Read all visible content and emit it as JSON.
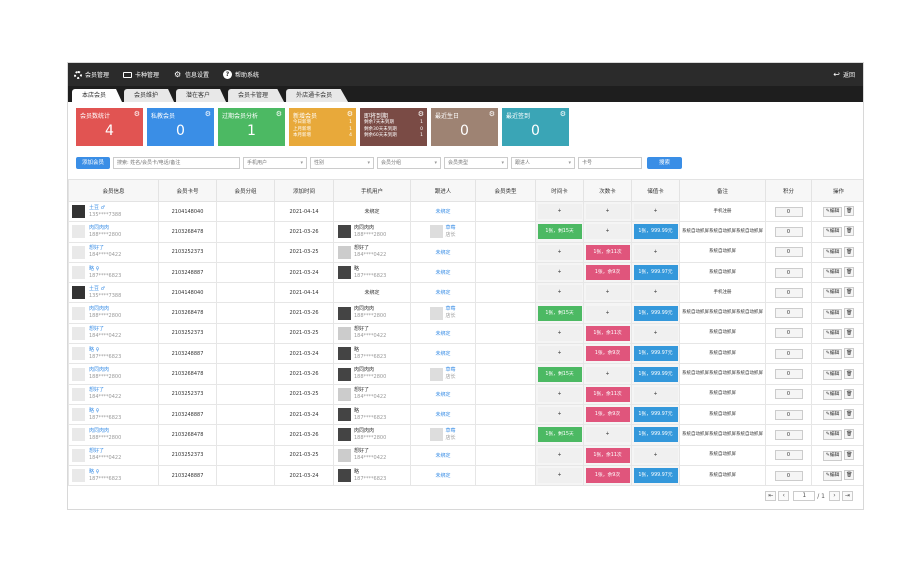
{
  "topnav": [
    {
      "label": "会员管理",
      "icon": "gear-icon"
    },
    {
      "label": "卡种管理",
      "icon": "card-icon"
    },
    {
      "label": "信息设置",
      "icon": "settings-icon"
    },
    {
      "label": "帮助系统",
      "icon": "help-icon"
    }
  ],
  "back_label": "返回",
  "tabs": [
    "本店会员",
    "会员维护",
    "潜在客户",
    "会员卡管理",
    "外店通卡会员"
  ],
  "cards": [
    {
      "title": "会员数统计",
      "value": "4",
      "color": "#e15452"
    },
    {
      "title": "私教会员",
      "value": "0",
      "color": "#3a8ee6"
    },
    {
      "title": "过期会员分析",
      "value": "1",
      "color": "#4cb963"
    },
    {
      "title": "新增会员",
      "color": "#e8a93a",
      "lines": [
        "今日新增",
        "上月新增",
        "本月新增"
      ],
      "counts": [
        "1",
        "1",
        "4"
      ]
    },
    {
      "title": "即将到期",
      "color": "#7a4b45",
      "lines": [
        "剩余7天未到期",
        "剩余30天未到期",
        "剩余60天未到期"
      ],
      "counts": [
        "1",
        "0",
        "1"
      ]
    },
    {
      "title": "最近生日",
      "value": "0",
      "color": "#9e8373"
    },
    {
      "title": "最近签到",
      "value": "0",
      "color": "#3aa5b6"
    }
  ],
  "filters": {
    "add_button": "添加会员",
    "search_placeholder": "搜索: 姓名/会员卡/电话/备注",
    "phone_user": "手机用户",
    "gender": "性别",
    "group": "会员分组",
    "type": "会员类型",
    "referrer": "跟进人",
    "card": "卡号",
    "search_button": "搜索"
  },
  "columns": [
    "会员信息",
    "会员卡号",
    "会员分组",
    "添加时间",
    "手机用户",
    "跟进人",
    "会员类型",
    "时间卡",
    "次数卡",
    "储值卡",
    "备注",
    "积分",
    "操作"
  ],
  "rows": [
    {
      "name": "土豆 ♂",
      "phone": "135****7388",
      "avatar": "d",
      "card": "2104148040",
      "date": "2021-04-14",
      "pu": "未绑定",
      "pu_av": "",
      "pu_phone": "",
      "ref": "未绑定",
      "ref_av": false,
      "time": "+",
      "time_c": "plain",
      "count": "+",
      "count_c": "plain",
      "stored": "+",
      "stored_c": "plain",
      "note": "手机注册",
      "score": "0"
    },
    {
      "name": "肉同肉肉",
      "phone": "188****2800",
      "avatar": "g",
      "card": "2103268478",
      "date": "2021-03-26",
      "pu": "肉同肉肉",
      "pu_av": "d",
      "pu_phone": "188****2800",
      "ref": "草莓",
      "ref_sub": "店长",
      "ref_av": true,
      "time": "1张，剩15天",
      "time_c": "green",
      "count": "+",
      "count_c": "plain",
      "stored": "1张，999.99元",
      "stored_c": "blue",
      "note": "系统自动抓屏系统自动抓屏系统自动抓屏",
      "score": "0"
    },
    {
      "name": "想好了",
      "phone": "184****0422",
      "avatar": "g",
      "card": "2103252373",
      "date": "2021-03-25",
      "pu": "想好了",
      "pu_av": "w",
      "pu_phone": "184****0422",
      "ref": "未绑定",
      "ref_av": false,
      "time": "+",
      "time_c": "plain",
      "count": "1张，余11次",
      "count_c": "pink",
      "stored": "+",
      "stored_c": "plain",
      "note": "系统自动抓屏",
      "score": "0"
    },
    {
      "name": "略 ♀",
      "phone": "187****6823",
      "avatar": "g",
      "card": "2103248887",
      "date": "2021-03-24",
      "pu": "略",
      "pu_av": "d",
      "pu_phone": "187****6823",
      "ref": "未绑定",
      "ref_av": false,
      "time": "+",
      "time_c": "plain",
      "count": "1张，余9次",
      "count_c": "pink",
      "stored": "1张，999.97元",
      "stored_c": "blue",
      "note": "系统自动抓屏",
      "score": "0"
    },
    {
      "name": "土豆 ♂",
      "phone": "135****7388",
      "avatar": "d",
      "card": "2104148040",
      "date": "2021-04-14",
      "pu": "未绑定",
      "pu_av": "",
      "pu_phone": "",
      "ref": "未绑定",
      "ref_av": false,
      "time": "+",
      "time_c": "plain",
      "count": "+",
      "count_c": "plain",
      "stored": "+",
      "stored_c": "plain",
      "note": "手机注册",
      "score": "0"
    },
    {
      "name": "肉同肉肉",
      "phone": "188****2800",
      "avatar": "g",
      "card": "2103268478",
      "date": "2021-03-26",
      "pu": "肉同肉肉",
      "pu_av": "d",
      "pu_phone": "188****2800",
      "ref": "草莓",
      "ref_sub": "店长",
      "ref_av": true,
      "time": "1张，剩15天",
      "time_c": "green",
      "count": "+",
      "count_c": "plain",
      "stored": "1张，999.99元",
      "stored_c": "blue",
      "note": "系统自动抓屏系统自动抓屏系统自动抓屏",
      "score": "0"
    },
    {
      "name": "想好了",
      "phone": "184****0422",
      "avatar": "g",
      "card": "2103252373",
      "date": "2021-03-25",
      "pu": "想好了",
      "pu_av": "w",
      "pu_phone": "184****0422",
      "ref": "未绑定",
      "ref_av": false,
      "time": "+",
      "time_c": "plain",
      "count": "1张，余11次",
      "count_c": "pink",
      "stored": "+",
      "stored_c": "plain",
      "note": "系统自动抓屏",
      "score": "0"
    },
    {
      "name": "略 ♀",
      "phone": "187****6823",
      "avatar": "g",
      "card": "2103248887",
      "date": "2021-03-24",
      "pu": "略",
      "pu_av": "d",
      "pu_phone": "187****6823",
      "ref": "未绑定",
      "ref_av": false,
      "time": "+",
      "time_c": "plain",
      "count": "1张，余9次",
      "count_c": "pink",
      "stored": "1张，999.97元",
      "stored_c": "blue",
      "note": "系统自动抓屏",
      "score": "0"
    },
    {
      "name": "肉同肉肉",
      "phone": "188****2800",
      "avatar": "g",
      "card": "2103268478",
      "date": "2021-03-26",
      "pu": "肉同肉肉",
      "pu_av": "d",
      "pu_phone": "188****2800",
      "ref": "草莓",
      "ref_sub": "店长",
      "ref_av": true,
      "time": "1张，剩15天",
      "time_c": "green",
      "count": "+",
      "count_c": "plain",
      "stored": "1张，999.99元",
      "stored_c": "blue",
      "note": "系统自动抓屏系统自动抓屏系统自动抓屏",
      "score": "0"
    },
    {
      "name": "想好了",
      "phone": "184****0422",
      "avatar": "g",
      "card": "2103252373",
      "date": "2021-03-25",
      "pu": "想好了",
      "pu_av": "w",
      "pu_phone": "184****0422",
      "ref": "未绑定",
      "ref_av": false,
      "time": "+",
      "time_c": "plain",
      "count": "1张，余11次",
      "count_c": "pink",
      "stored": "+",
      "stored_c": "plain",
      "note": "系统自动抓屏",
      "score": "0"
    },
    {
      "name": "略 ♀",
      "phone": "187****6823",
      "avatar": "g",
      "card": "2103248887",
      "date": "2021-03-24",
      "pu": "略",
      "pu_av": "d",
      "pu_phone": "187****6823",
      "ref": "未绑定",
      "ref_av": false,
      "time": "+",
      "time_c": "plain",
      "count": "1张，余9次",
      "count_c": "pink",
      "stored": "1张，999.97元",
      "stored_c": "blue",
      "note": "系统自动抓屏",
      "score": "0"
    },
    {
      "name": "肉同肉肉",
      "phone": "188****2800",
      "avatar": "g",
      "card": "2103268478",
      "date": "2021-03-26",
      "pu": "肉同肉肉",
      "pu_av": "d",
      "pu_phone": "188****2800",
      "ref": "草莓",
      "ref_sub": "店长",
      "ref_av": true,
      "time": "1张，剩15天",
      "time_c": "green",
      "count": "+",
      "count_c": "plain",
      "stored": "1张，999.99元",
      "stored_c": "blue",
      "note": "系统自动抓屏系统自动抓屏系统自动抓屏",
      "score": "0"
    },
    {
      "name": "想好了",
      "phone": "184****0422",
      "avatar": "g",
      "card": "2103252373",
      "date": "2021-03-25",
      "pu": "想好了",
      "pu_av": "w",
      "pu_phone": "184****0422",
      "ref": "未绑定",
      "ref_av": false,
      "time": "+",
      "time_c": "plain",
      "count": "1张，余11次",
      "count_c": "pink",
      "stored": "+",
      "stored_c": "plain",
      "note": "系统自动抓屏",
      "score": "0"
    },
    {
      "name": "略 ♀",
      "phone": "187****6823",
      "avatar": "g",
      "card": "2103248887",
      "date": "2021-03-24",
      "pu": "略",
      "pu_av": "d",
      "pu_phone": "187****6823",
      "ref": "未绑定",
      "ref_av": false,
      "time": "+",
      "time_c": "plain",
      "count": "1张，余9次",
      "count_c": "pink",
      "stored": "1张，999.97元",
      "stored_c": "blue",
      "note": "系统自动抓屏",
      "score": "0"
    }
  ],
  "edit_label": "✎编辑",
  "delete_label": "🗑",
  "pager": {
    "page": "1",
    "total": "/ 1"
  }
}
